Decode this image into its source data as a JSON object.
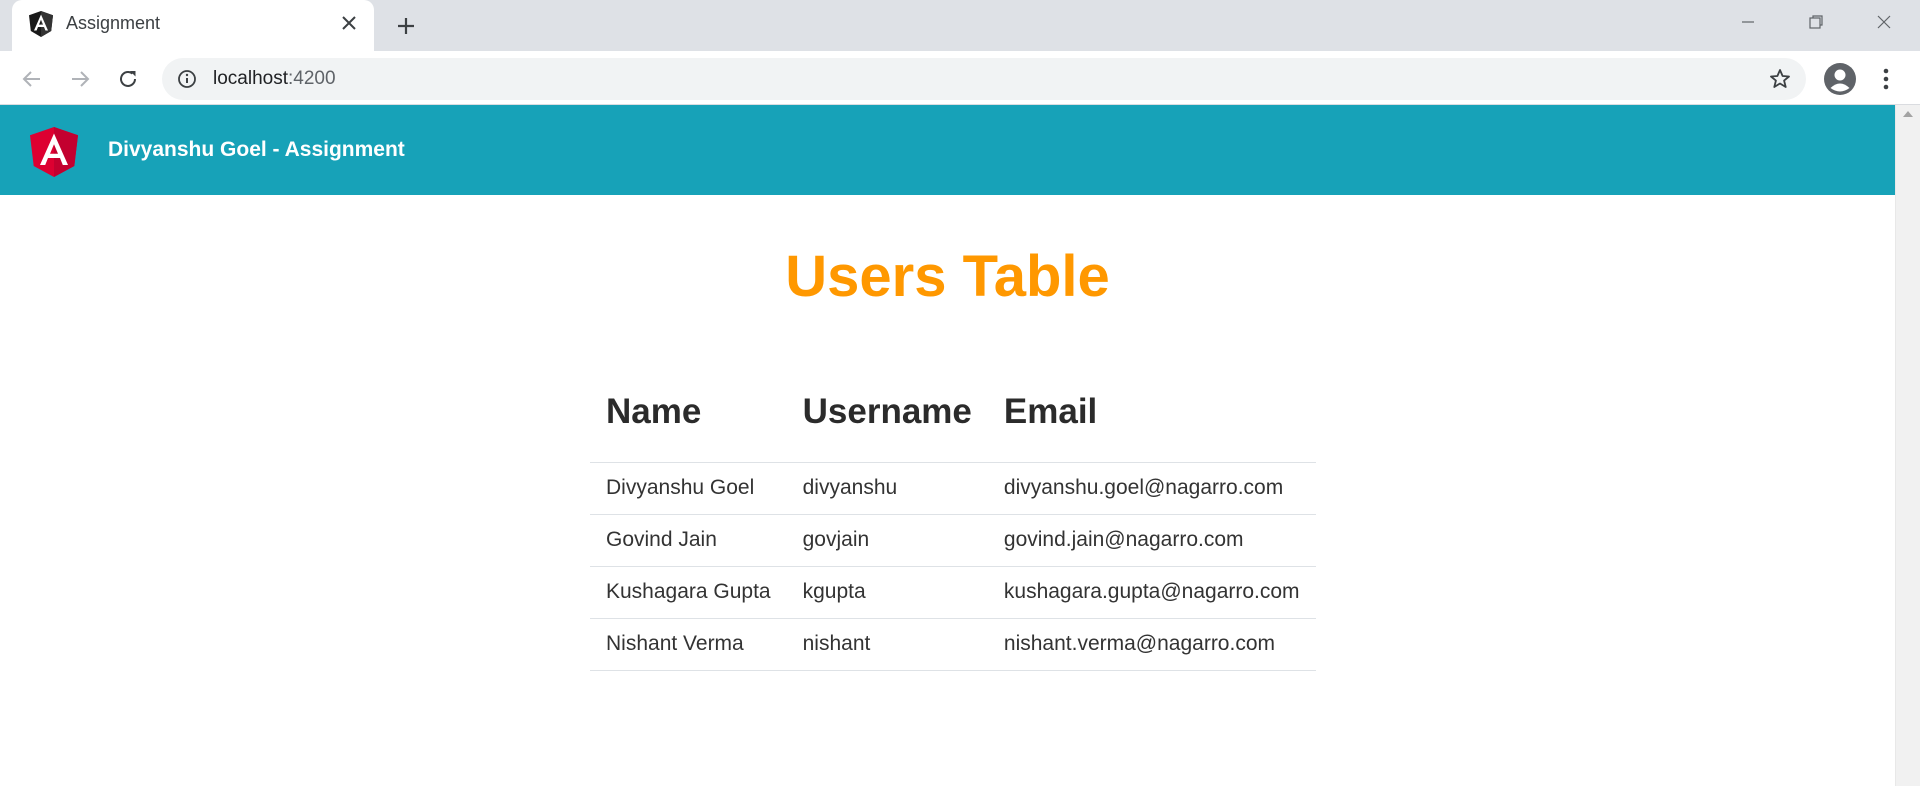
{
  "browser": {
    "tab_title": "Assignment",
    "url_host": "localhost",
    "url_port": ":4200",
    "icons": [
      "angular-favicon",
      "close-icon",
      "plus-icon",
      "minimize-icon",
      "restore-icon",
      "window-close-icon",
      "back-arrow-icon",
      "forward-arrow-icon",
      "reload-icon",
      "info-icon",
      "star-icon",
      "profile-icon",
      "more-vert-icon"
    ]
  },
  "navbar": {
    "brand": "Divyanshu Goel - Assignment",
    "color": "#17a2b8"
  },
  "main": {
    "title": "Users Table",
    "title_color": "#ff9800"
  },
  "table": {
    "headers": [
      "Name",
      "Username",
      "Email"
    ],
    "rows": [
      [
        "Divyanshu Goel",
        "divyanshu",
        "divyanshu.goel@nagarro.com"
      ],
      [
        "Govind Jain",
        "govjain",
        "govind.jain@nagarro.com"
      ],
      [
        "Kushagara Gupta",
        "kgupta",
        "kushagara.gupta@nagarro.com"
      ],
      [
        "Nishant Verma",
        "nishant",
        "nishant.verma@nagarro.com"
      ]
    ]
  }
}
